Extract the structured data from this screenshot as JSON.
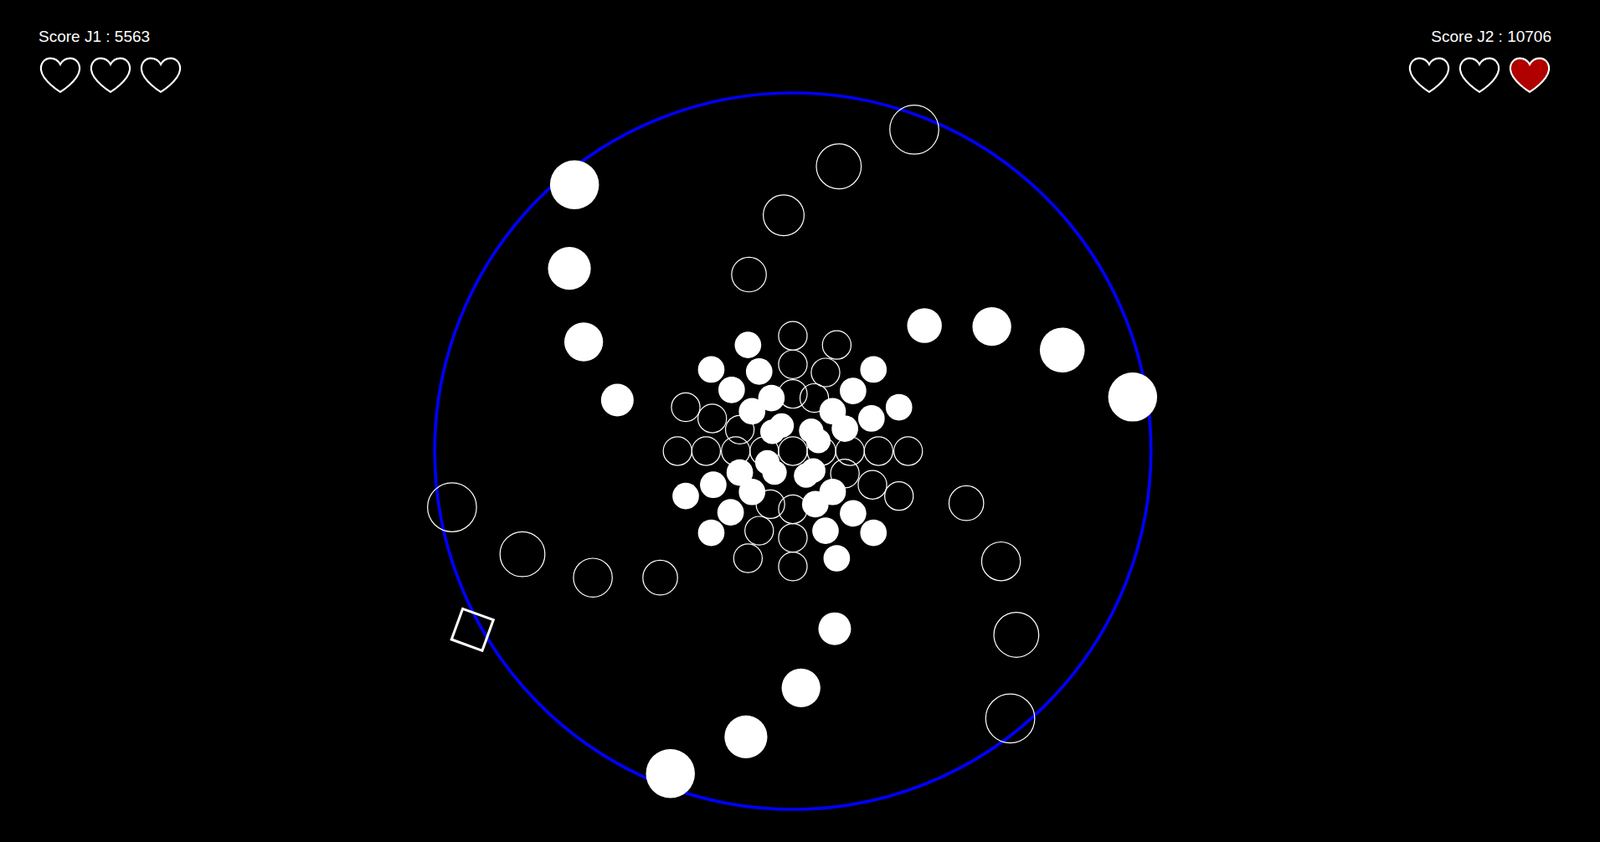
{
  "players": [
    {
      "score": "Score J1 : 5563",
      "hearts": [
        {
          "filled": false
        },
        {
          "filled": false
        },
        {
          "filled": false
        }
      ]
    },
    {
      "score": "Score J2 : 10706",
      "hearts": [
        {
          "filled": false
        },
        {
          "filled": false
        },
        {
          "filled": true
        }
      ]
    }
  ],
  "orbs": [
    {
      "filled": true
    },
    {
      "filled": true
    },
    {
      "filled": true
    },
    {
      "filled": true
    },
    {
      "filled": false
    },
    {
      "filled": false
    },
    {
      "filled": false
    },
    {
      "filled": false
    },
    {
      "filled": true
    },
    {
      "filled": true
    },
    {
      "filled": true
    },
    {
      "filled": true
    },
    {
      "filled": false
    },
    {
      "filled": false
    },
    {
      "filled": false
    },
    {
      "filled": false
    },
    {
      "filled": true
    },
    {
      "filled": true
    },
    {
      "filled": true
    },
    {
      "filled": true
    },
    {
      "filled": false
    },
    {
      "filled": false
    },
    {
      "filled": false
    },
    {
      "filled": false
    },
    {
      "filled": true
    },
    {
      "filled": true
    },
    {
      "filled": true
    },
    {
      "filled": true
    },
    {
      "filled": true
    },
    {
      "filled": true
    },
    {
      "filled": true
    },
    {
      "filled": true
    },
    {
      "filled": true
    },
    {
      "filled": true
    },
    {
      "filled": true
    },
    {
      "filled": true
    },
    {
      "filled": true
    },
    {
      "filled": true
    },
    {
      "filled": true
    },
    {
      "filled": true
    },
    {
      "filled": true
    },
    {
      "filled": true
    },
    {
      "filled": true
    },
    {
      "filled": true
    },
    {
      "filled": true
    },
    {
      "filled": true
    },
    {
      "filled": true
    },
    {
      "filled": true
    },
    {
      "filled": true
    },
    {
      "filled": true
    },
    {
      "filled": true
    },
    {
      "filled": true
    },
    {
      "filled": true
    },
    {
      "filled": true
    },
    {
      "filled": true
    },
    {
      "filled": true
    },
    {
      "filled": false
    },
    {
      "filled": false
    },
    {
      "filled": false
    },
    {
      "filled": false
    },
    {
      "filled": false
    },
    {
      "filled": false
    },
    {
      "filled": false
    },
    {
      "filled": false
    },
    {
      "filled": false
    },
    {
      "filled": false
    },
    {
      "filled": false
    },
    {
      "filled": false
    },
    {
      "filled": false
    },
    {
      "filled": false
    },
    {
      "filled": false
    },
    {
      "filled": false
    },
    {
      "filled": false
    },
    {
      "filled": false
    },
    {
      "filled": false
    },
    {
      "filled": false
    },
    {
      "filled": false
    },
    {
      "filled": false
    },
    {
      "filled": false
    },
    {
      "filled": false
    },
    {
      "filled": false
    },
    {
      "filled": false
    },
    {
      "filled": false
    }
  ]
}
